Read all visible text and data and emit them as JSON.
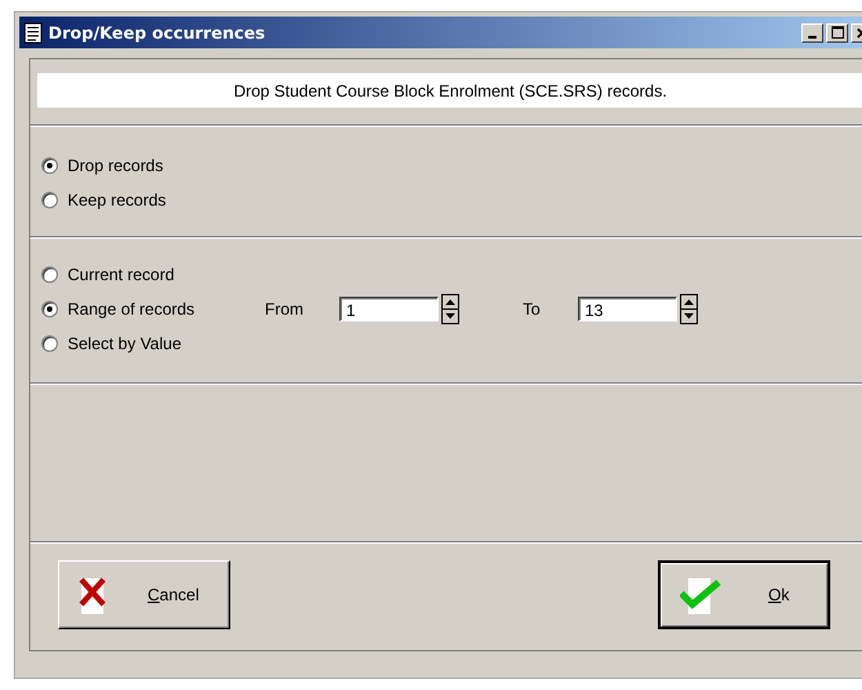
{
  "window": {
    "title": "Drop/Keep occurrences"
  },
  "message": "Drop Student Course Block Enrolment (SCE.SRS) records.",
  "action_options": [
    {
      "label": "Drop records",
      "selected": true
    },
    {
      "label": "Keep records",
      "selected": false
    }
  ],
  "scope_options": [
    {
      "label": "Current record",
      "selected": false
    },
    {
      "label": "Range of records",
      "selected": true,
      "range": {
        "from_label": "From",
        "from_value": "1",
        "to_label": "To",
        "to_value": "13"
      }
    },
    {
      "label": "Select by Value",
      "selected": false
    }
  ],
  "buttons": [
    {
      "label": "Cancel",
      "kind": "cancel",
      "default": false
    },
    {
      "label": "Ok",
      "kind": "ok",
      "default": true
    }
  ]
}
